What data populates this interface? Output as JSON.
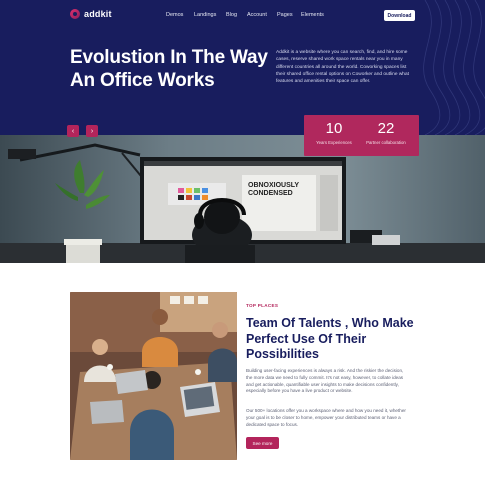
{
  "brand": {
    "name": "addkit"
  },
  "nav": {
    "items": [
      {
        "label": "Demos"
      },
      {
        "label": "Landings"
      },
      {
        "label": "Blog"
      },
      {
        "label": "Account"
      },
      {
        "label": "Pages"
      },
      {
        "label": "Elements"
      }
    ],
    "download_label": "Download"
  },
  "hero": {
    "title_line1": "Evolustion In The Way",
    "title_line2": "An Office Works",
    "description": "Addkit is a website where you can search, find, and hire some cases, reserve shared work space rentals near you in many different countries all around the world. Coworking spaces list their shared office rental options on Coworker and outline what features and amenities their space can offer.",
    "prev_icon": "‹",
    "next_icon": "›"
  },
  "stats": [
    {
      "value": "10",
      "label": "Years Experiences"
    },
    {
      "value": "22",
      "label": "Partner collaboration"
    }
  ],
  "monitor": {
    "screen_text_1": "OBNOXIOUSLY",
    "screen_text_2": "CONDENSED"
  },
  "team": {
    "eyebrow": "TOP PLACES",
    "title_line1": "Team Of Talents , Who Make",
    "title_line2": "Perfect Use Of Their",
    "title_line3": "Possibilities",
    "para1": "Building user-facing experiences is always a risk. And the riskier the decision, the more data we need to fully commit. It's not easy, however, to collate ideas and get actionable, quantifiable user insights to make decisions confidently, especially before you have a live product or website.",
    "para2": "Our 500+ locations offer you a workspace where and how you need it, whether your goal is to be closer to home, empower your distributed teams or have a dedicated space to focus.",
    "button_label": "See more"
  },
  "colors": {
    "navy": "#181d5e",
    "accent": "#b3245b"
  }
}
